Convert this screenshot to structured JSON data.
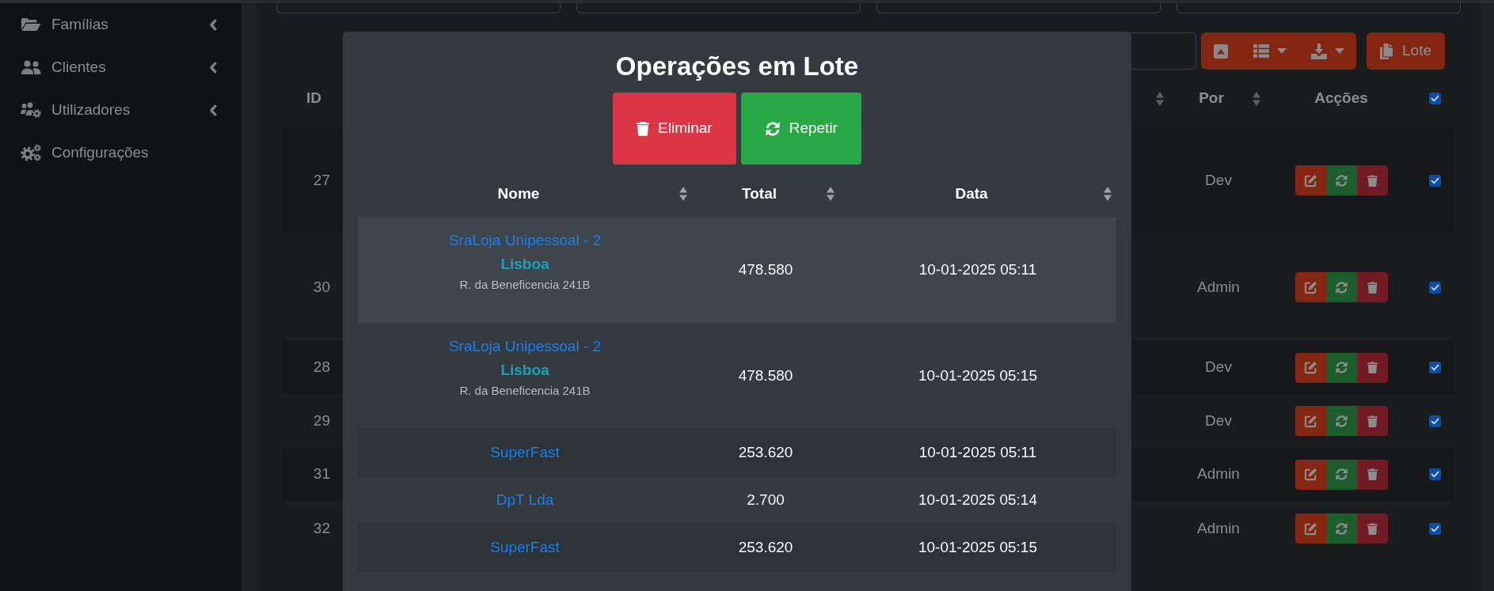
{
  "sidebar": {
    "items": [
      {
        "label": "Famílias",
        "kind": "group"
      },
      {
        "label": "Clientes",
        "kind": "group"
      },
      {
        "label": "Utilizadores",
        "kind": "group"
      },
      {
        "label": "Configurações",
        "kind": "link"
      }
    ]
  },
  "toolbar": {
    "lote_button": {
      "label": "Lote"
    }
  },
  "table": {
    "columns": [
      {
        "label": "ID",
        "sortable": false
      },
      {
        "sortable": true
      },
      {
        "label": "Por",
        "sortable": true
      },
      {
        "label": "Acções",
        "sortable": false
      }
    ],
    "select_all": {
      "checked": true
    },
    "rows": [
      {
        "id": "27",
        "por": "Dev",
        "checked": true
      },
      {
        "id": "30",
        "por": "Admin",
        "checked": true
      },
      {
        "id": "28",
        "por": "Dev",
        "checked": true
      },
      {
        "id": "29",
        "por": "Dev",
        "checked": true
      },
      {
        "id": "31",
        "por": "Admin",
        "checked": true
      },
      {
        "id": "32",
        "por": "Admin",
        "checked": true
      }
    ]
  },
  "dialog": {
    "title": "Operações em Lote",
    "actions": [
      {
        "label": "Eliminar",
        "kind": "delete"
      },
      {
        "label": "Repetir",
        "kind": "repeat"
      }
    ],
    "table": {
      "columns": [
        {
          "label": "Nome",
          "sortable": true
        },
        {
          "label": "Total",
          "sortable": true
        },
        {
          "label": "Data",
          "sortable": true
        }
      ],
      "rows": [
        {
          "name": "SraLoja Unipessoal - 2",
          "city": "Lisboa",
          "address": "R. da Beneficencia 241B",
          "total": "478.580",
          "date": "10-01-2025 05:11",
          "highlighted": true
        },
        {
          "name": "SraLoja Unipessoal - 2",
          "city": "Lisboa",
          "address": "R. da Beneficencia 241B",
          "total": "478.580",
          "date": "10-01-2025 05:15",
          "highlighted": false
        },
        {
          "name": "SuperFast",
          "total": "253.620",
          "date": "10-01-2025 05:11",
          "highlighted": false
        },
        {
          "name": "DpT Lda",
          "total": "2.700",
          "date": "10-01-2025 05:14",
          "highlighted": false
        },
        {
          "name": "SuperFast",
          "total": "253.620",
          "date": "10-01-2025 05:15",
          "highlighted": false
        }
      ]
    }
  }
}
